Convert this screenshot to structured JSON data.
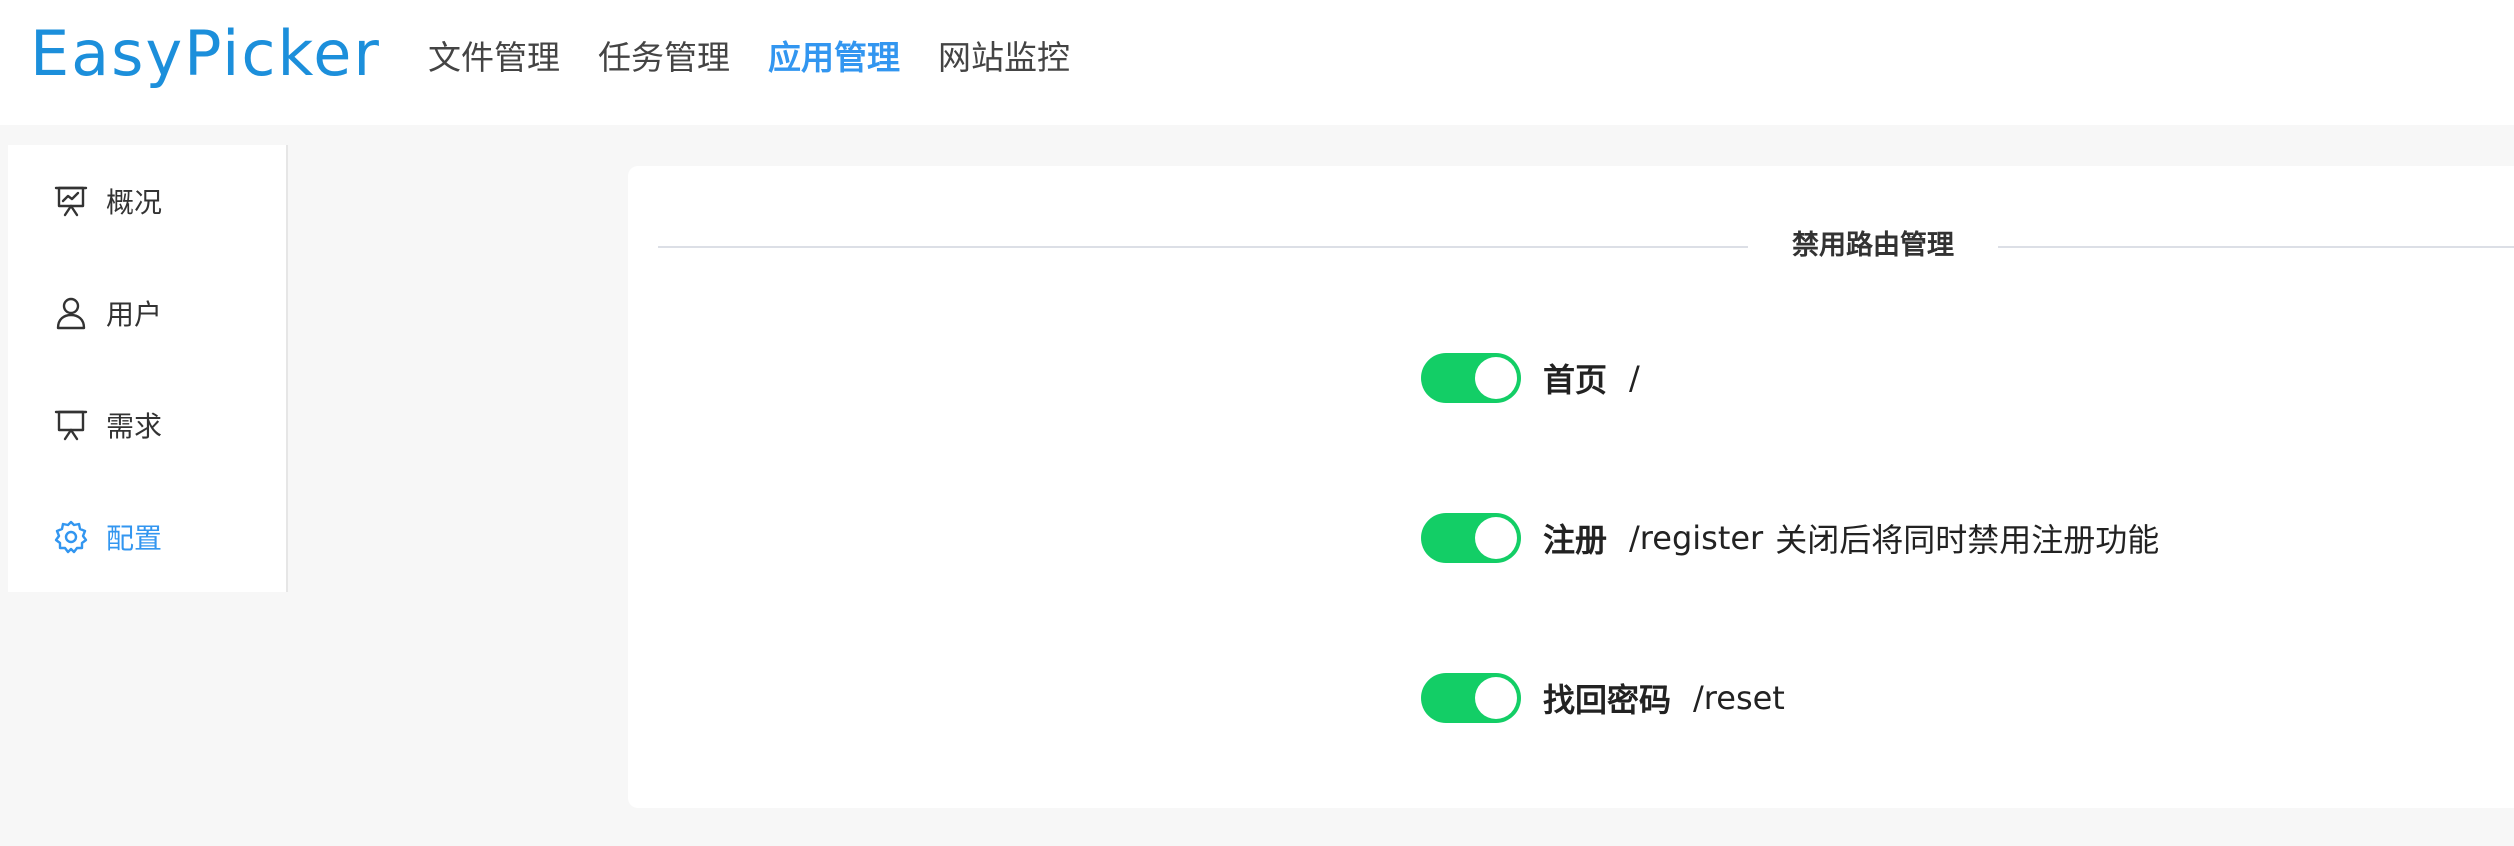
{
  "header": {
    "logo": "EasyPicker",
    "nav": [
      {
        "label": "文件管理"
      },
      {
        "label": "任务管理"
      },
      {
        "label": "应用管理"
      },
      {
        "label": "网站监控"
      }
    ],
    "active_nav": "应用管理"
  },
  "sidebar": {
    "items": [
      {
        "label": "概况",
        "icon": "presentation-chart-icon"
      },
      {
        "label": "用户",
        "icon": "user-icon"
      },
      {
        "label": "需求",
        "icon": "presentation-board-icon"
      },
      {
        "label": "配置",
        "icon": "gear-icon"
      }
    ],
    "active_item": "配置"
  },
  "card": {
    "section_title": "禁用路由管理",
    "routes": [
      {
        "name": "首页",
        "path": "/",
        "note": "",
        "enabled": true
      },
      {
        "name": "注册",
        "path": "/register",
        "note": "关闭后将同时禁用注册功能",
        "enabled": true
      },
      {
        "name": "找回密码",
        "path": "/reset",
        "note": "",
        "enabled": true
      }
    ]
  },
  "colors": {
    "accent": "#3296f0",
    "logo": "#1c8fdb",
    "switch_on": "#13ce66"
  }
}
